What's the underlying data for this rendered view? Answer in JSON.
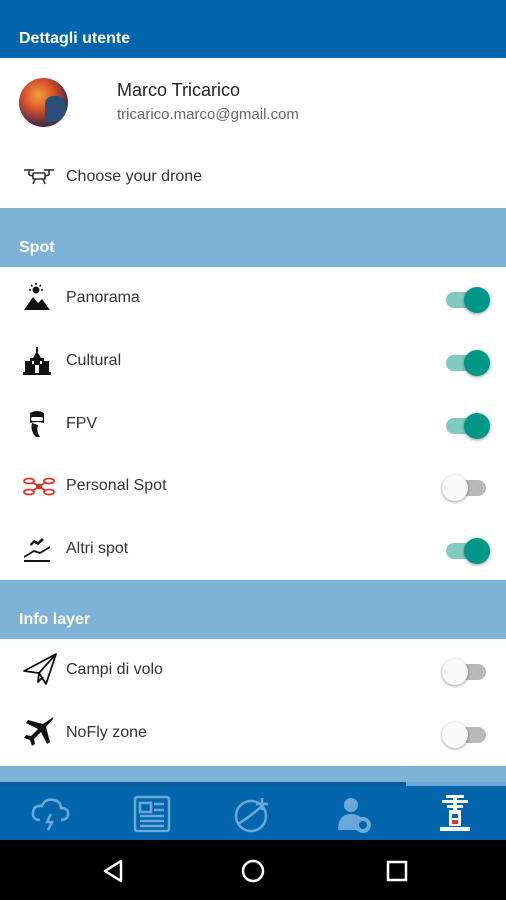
{
  "header": {
    "title": "Dettagli utente"
  },
  "user": {
    "name": "Marco Tricarico",
    "email": "tricarico.marco@gmail.com"
  },
  "drone": {
    "label": "Choose your drone",
    "icon": "drone-icon"
  },
  "spot": {
    "title": "Spot",
    "items": [
      {
        "label": "Panorama",
        "icon": "panorama-icon",
        "enabled": true
      },
      {
        "label": "Cultural",
        "icon": "cultural-icon",
        "enabled": true
      },
      {
        "label": "FPV",
        "icon": "fpv-icon",
        "enabled": true
      },
      {
        "label": "Personal Spot",
        "icon": "personal-spot-icon",
        "enabled": false
      },
      {
        "label": "Altri spot",
        "icon": "altri-spot-icon",
        "enabled": true
      }
    ]
  },
  "info_layer": {
    "title": "Info layer",
    "items": [
      {
        "label": "Campi di volo",
        "icon": "paper-plane-icon",
        "enabled": false
      },
      {
        "label": "NoFly zone",
        "icon": "airplane-icon",
        "enabled": false
      }
    ]
  },
  "bottom_nav": {
    "tabs": [
      {
        "icon": "weather-icon",
        "active": false
      },
      {
        "icon": "news-icon",
        "active": false
      },
      {
        "icon": "map-drone-icon",
        "active": false
      },
      {
        "icon": "community-icon",
        "active": false
      },
      {
        "icon": "settings-tower-icon",
        "active": true
      }
    ]
  },
  "colors": {
    "primary": "#0365ac",
    "section": "#7fb2d7",
    "toggle_on": "#009688",
    "toggle_on_track": "#7fcbc1",
    "toggle_off_track": "#b9b9b9"
  }
}
